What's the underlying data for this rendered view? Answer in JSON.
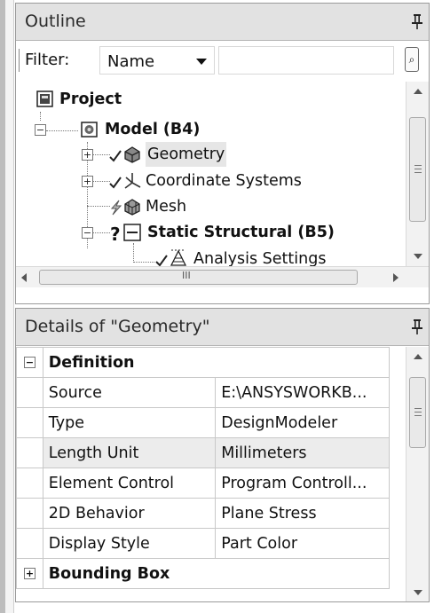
{
  "outline": {
    "title": "Outline",
    "filter_label": "Filter:",
    "filter_value": "Name",
    "filter_input_value": "",
    "tree": {
      "project": "Project",
      "model": "Model (B4)",
      "geometry": "Geometry",
      "coordinate_systems": "Coordinate Systems",
      "mesh": "Mesh",
      "static_structural": "Static Structural (B5)",
      "analysis_settings": "Analysis Settings"
    },
    "h_scroll_grip": "III"
  },
  "details": {
    "title": "Details of \"Geometry\"",
    "groups": [
      {
        "label": "Definition",
        "expanded": true
      },
      {
        "label": "Bounding Box",
        "expanded": false
      }
    ],
    "rows": [
      {
        "name": "Source",
        "value": "E:\\ANSYSWORKB..."
      },
      {
        "name": "Type",
        "value": "DesignModeler"
      },
      {
        "name": "Length Unit",
        "value": "Millimeters"
      },
      {
        "name": "Element Control",
        "value": "Program Controll..."
      },
      {
        "name": "2D Behavior",
        "value": "Plane Stress"
      },
      {
        "name": "Display Style",
        "value": "Part Color"
      }
    ]
  },
  "icons": {
    "pin": "pin-icon",
    "expand_minus": "−",
    "expand_plus": "+"
  },
  "colors": {
    "header_bg": "#e2e2e2",
    "selection_bg": "#e6e6e6",
    "shaded_cell": "#ececec",
    "question_mark": "#111111"
  }
}
